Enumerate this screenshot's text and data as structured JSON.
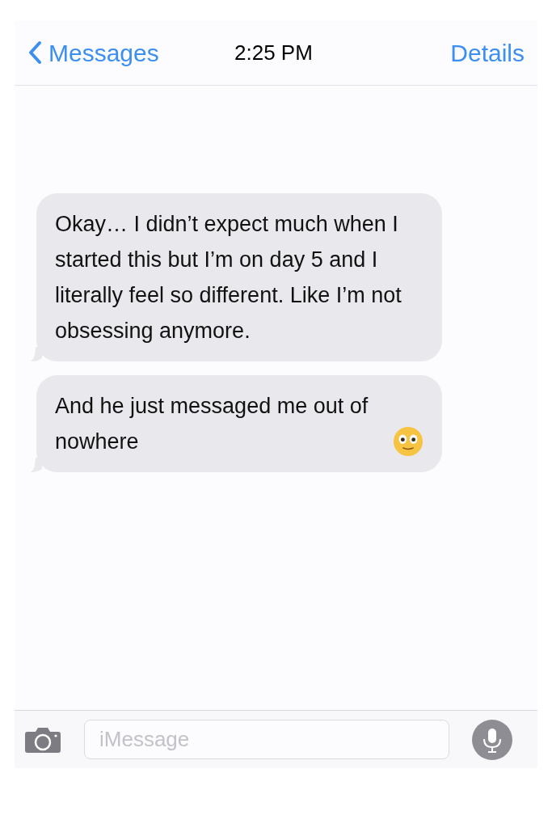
{
  "header": {
    "back_label": "Messages",
    "time": "2:25 PM",
    "details_label": "Details"
  },
  "messages": [
    {
      "text": "Okay… I didn’t expect much when I started this but I’m on day 5 and I literally feel so different. Like I’m not obsessing anymore.",
      "emoji": false
    },
    {
      "text": "And he just messaged me out of nowhere",
      "emoji": true
    }
  ],
  "composer": {
    "placeholder": "iMessage"
  }
}
